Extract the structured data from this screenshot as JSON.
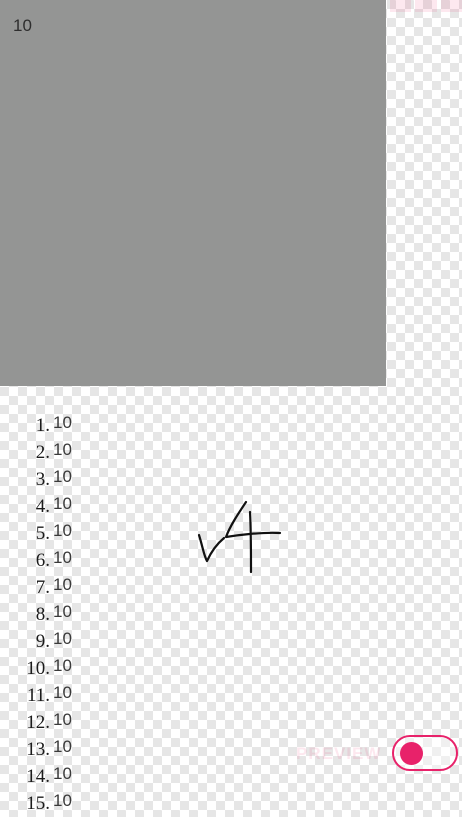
{
  "panel": {
    "text": "10"
  },
  "list": {
    "items": [
      {
        "num": "1.",
        "value": "10"
      },
      {
        "num": "2.",
        "value": "10"
      },
      {
        "num": "3.",
        "value": "10"
      },
      {
        "num": "4.",
        "value": "10"
      },
      {
        "num": "5.",
        "value": "10"
      },
      {
        "num": "6.",
        "value": "10"
      },
      {
        "num": "7.",
        "value": "10"
      },
      {
        "num": "8.",
        "value": "10"
      },
      {
        "num": "9.",
        "value": "10"
      },
      {
        "num": "10.",
        "value": "10"
      },
      {
        "num": "11.",
        "value": "10"
      },
      {
        "num": "12.",
        "value": "10"
      },
      {
        "num": "13.",
        "value": "10"
      },
      {
        "num": "14.",
        "value": "10"
      },
      {
        "num": "15.",
        "value": "10"
      }
    ]
  },
  "preview": {
    "label": "PREVIEW",
    "toggle_on": true
  },
  "colors": {
    "panel": "#949594",
    "accent": "#e8226a"
  }
}
